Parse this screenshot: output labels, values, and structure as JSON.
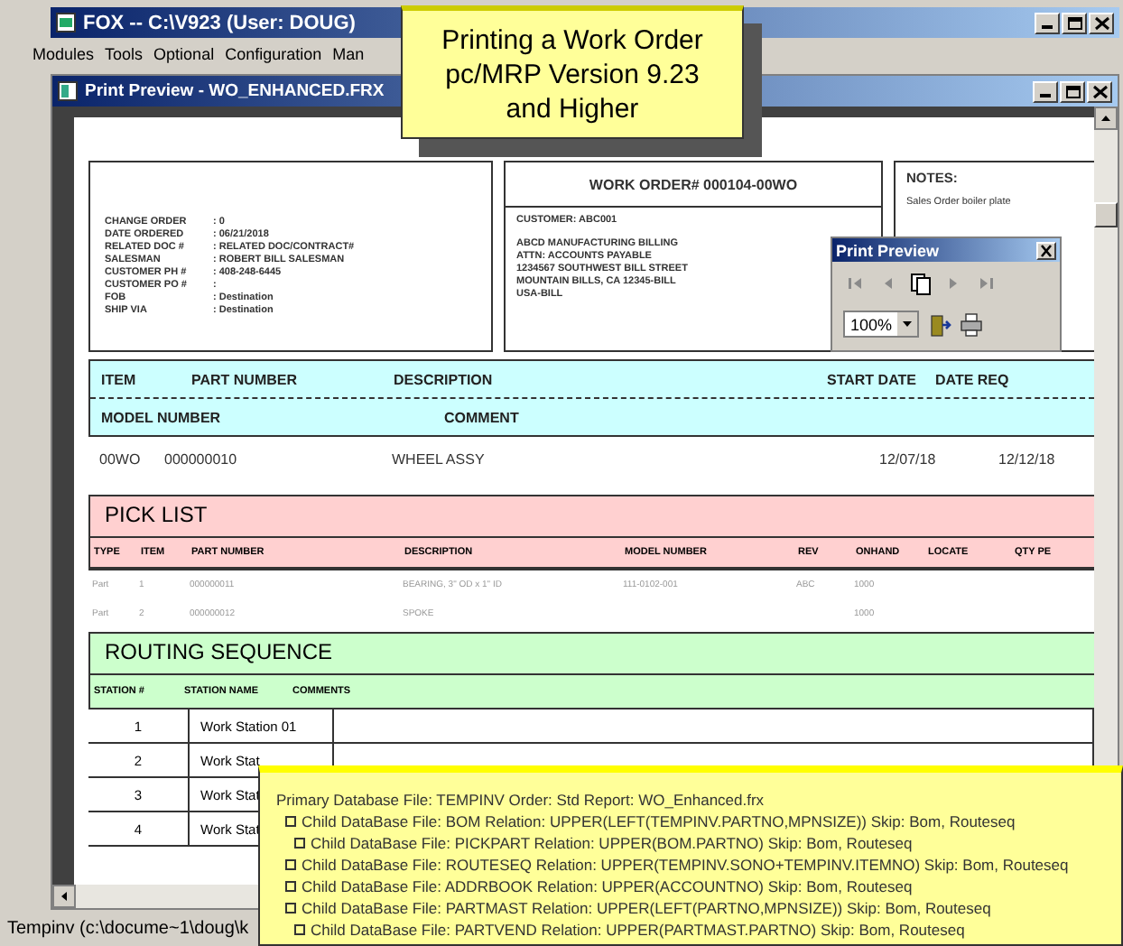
{
  "window": {
    "title": "FOX -- C:\\V923  (User: DOUG)"
  },
  "menu": [
    "Modules",
    "Tools",
    "Optional",
    "Configuration",
    "Man"
  ],
  "preview_window": {
    "title": "Print Preview - WO_ENHANCED.FRX"
  },
  "callout": {
    "lines": [
      "Printing a Work Order",
      "pc/MRP Version 9.23",
      "and Higher"
    ]
  },
  "order_fields": [
    {
      "label": "CHANGE ORDER",
      "value": ": 0"
    },
    {
      "label": "DATE ORDERED",
      "value": ": 06/21/2018"
    },
    {
      "label": "RELATED DOC #",
      "value": ": RELATED DOC/CONTRACT#"
    },
    {
      "label": "SALESMAN",
      "value": ": ROBERT BILL SALESMAN"
    },
    {
      "label": "CUSTOMER PH #",
      "value": ": 408-248-6445"
    },
    {
      "label": "CUSTOMER PO #",
      "value": ":"
    },
    {
      "label": "FOB",
      "value": ": Destination"
    },
    {
      "label": "SHIP VIA",
      "value": ": Destination"
    }
  ],
  "work_order": {
    "title": "WORK ORDER#  000104-00WO",
    "customer": "CUSTOMER: ABC001",
    "address": [
      "ABCD MANUFACTURING BILLING",
      "ATTN: ACCOUNTS PAYABLE",
      "1234567 SOUTHWEST BILL STREET",
      "MOUNTAIN BILLS, CA 12345-BILL",
      "USA-BILL"
    ]
  },
  "notes": {
    "title": "NOTES:",
    "text": "Sales Order boiler plate"
  },
  "item_header": {
    "row_1": [
      "ITEM",
      "PART NUMBER",
      "DESCRIPTION",
      "START DATE",
      "DATE REQ"
    ],
    "row_2": [
      "MODEL NUMBER",
      "COMMENT"
    ]
  },
  "item_row": [
    "00WO",
    "000000010",
    "WHEEL ASSY",
    "12/07/18",
    "12/12/18"
  ],
  "pick_list": {
    "title": "PICK LIST",
    "columns": [
      "TYPE",
      "ITEM",
      "PART NUMBER",
      "DESCRIPTION",
      "MODEL NUMBER",
      "REV",
      "ONHAND",
      "LOCATE",
      "QTY PE"
    ],
    "rows": [
      [
        "Part",
        "1",
        "000000011",
        "BEARING, 3\" OD x 1\" ID",
        "111-0102-001",
        "ABC",
        "1000",
        "",
        ""
      ],
      [
        "Part",
        "2",
        "000000012",
        "SPOKE",
        "",
        "",
        "1000",
        "",
        ""
      ]
    ]
  },
  "routing": {
    "title": "ROUTING SEQUENCE",
    "columns": [
      "STATION #",
      "STATION NAME",
      "COMMENTS"
    ],
    "rows": [
      [
        "1",
        "Work Station 01"
      ],
      [
        "2",
        "Work Stat"
      ],
      [
        "3",
        "Work Stat"
      ],
      [
        "4",
        "Work Stat"
      ]
    ]
  },
  "print_preview_toolbar": {
    "title": "Print Preview",
    "zoom": "100%",
    "buttons": [
      {
        "kind": "first",
        "disabled": true
      },
      {
        "kind": "prev",
        "disabled": true
      },
      {
        "kind": "page",
        "disabled": false
      },
      {
        "kind": "next",
        "disabled": true
      },
      {
        "kind": "last",
        "disabled": true
      }
    ]
  },
  "info_box": {
    "title": "Primary Database File: TEMPINV Order:   Std Report: WO_Enhanced.frx",
    "children": [
      {
        "text": "Child DataBase File: BOM Relation: UPPER(LEFT(TEMPINV.PARTNO,MPNSIZE)) Skip: Bom, Routeseq",
        "children": [
          {
            "text": "Child DataBase File: PICKPART Relation: UPPER(BOM.PARTNO) Skip: Bom, Routeseq"
          }
        ]
      },
      {
        "text": "Child DataBase File: ROUTESEQ Relation: UPPER(TEMPINV.SONO+TEMPINV.ITEMNO) Skip: Bom, Routeseq"
      },
      {
        "text": "Child DataBase File: ADDRBOOK Relation: UPPER(ACCOUNTNO) Skip: Bom, Routeseq"
      },
      {
        "text": "Child DataBase File: PARTMAST Relation: UPPER(LEFT(PARTNO,MPNSIZE)) Skip: Bom, Routeseq",
        "children": [
          {
            "text": "Child DataBase File: PARTVEND Relation: UPPER(PARTMAST.PARTNO) Skip: Bom, Routeseq"
          }
        ]
      }
    ]
  },
  "status_bar": {
    "text": "Tempinv (c:\\docume~1\\doug\\k"
  }
}
